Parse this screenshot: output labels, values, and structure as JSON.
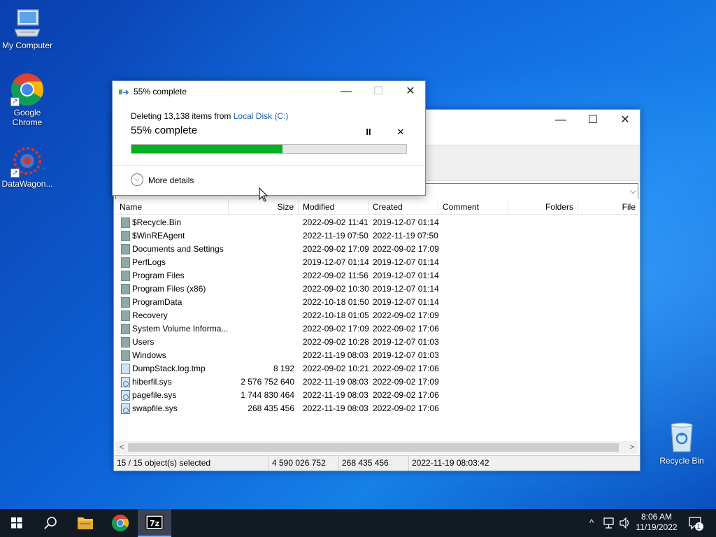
{
  "desktop": {
    "icons": [
      {
        "label": "My Computer"
      },
      {
        "label": "Google Chrome"
      },
      {
        "label": "DataWagon..."
      },
      {
        "label": "Recycle Bin"
      }
    ]
  },
  "progress_dialog": {
    "title": "55% complete",
    "deleting_prefix": "Deleting 13,138 items from ",
    "location_link": "Local Disk (C:)",
    "status_text": "55% complete",
    "progress_percent": 55,
    "more_details": "More details",
    "pause_glyph": "II",
    "cancel_glyph": "✕"
  },
  "window_controls": {
    "minimize": "—",
    "maximize": "☐",
    "close": "✕"
  },
  "file_list": {
    "columns": [
      "Name",
      "Size",
      "Modified",
      "Created",
      "Comment",
      "Folders",
      "File"
    ],
    "rows": [
      {
        "name": "$Recycle.Bin",
        "size": "",
        "modified": "2022-09-02 11:41",
        "created": "2019-12-07 01:14",
        "type": "folder"
      },
      {
        "name": "$WinREAgent",
        "size": "",
        "modified": "2022-11-19 07:50",
        "created": "2022-11-19 07:50",
        "type": "folder"
      },
      {
        "name": "Documents and Settings",
        "size": "",
        "modified": "2022-09-02 17:09",
        "created": "2022-09-02 17:09",
        "type": "folder"
      },
      {
        "name": "PerfLogs",
        "size": "",
        "modified": "2019-12-07 01:14",
        "created": "2019-12-07 01:14",
        "type": "folder"
      },
      {
        "name": "Program Files",
        "size": "",
        "modified": "2022-09-02 11:56",
        "created": "2019-12-07 01:14",
        "type": "folder"
      },
      {
        "name": "Program Files (x86)",
        "size": "",
        "modified": "2022-09-02 10:30",
        "created": "2019-12-07 01:14",
        "type": "folder"
      },
      {
        "name": "ProgramData",
        "size": "",
        "modified": "2022-10-18 01:50",
        "created": "2019-12-07 01:14",
        "type": "folder"
      },
      {
        "name": "Recovery",
        "size": "",
        "modified": "2022-10-18 01:05",
        "created": "2022-09-02 17:09",
        "type": "folder"
      },
      {
        "name": "System Volume Informa...",
        "size": "",
        "modified": "2022-09-02 17:09",
        "created": "2022-09-02 17:06",
        "type": "folder"
      },
      {
        "name": "Users",
        "size": "",
        "modified": "2022-09-02 10:28",
        "created": "2019-12-07 01:03",
        "type": "folder"
      },
      {
        "name": "Windows",
        "size": "",
        "modified": "2022-11-19 08:03",
        "created": "2019-12-07 01:03",
        "type": "folder"
      },
      {
        "name": "DumpStack.log.tmp",
        "size": "8 192",
        "modified": "2022-09-02 10:21",
        "created": "2022-09-02 17:06",
        "type": "file"
      },
      {
        "name": "hiberfil.sys",
        "size": "2 576 752 640",
        "modified": "2022-11-19 08:03",
        "created": "2022-09-02 17:09",
        "type": "sysfile"
      },
      {
        "name": "pagefile.sys",
        "size": "1 744 830 464",
        "modified": "2022-11-19 08:03",
        "created": "2022-09-02 17:06",
        "type": "sysfile"
      },
      {
        "name": "swapfile.sys",
        "size": "268 435 456",
        "modified": "2022-11-19 08:03",
        "created": "2022-09-02 17:06",
        "type": "sysfile"
      }
    ]
  },
  "status_bar": {
    "selected": "15 / 15 object(s) selected",
    "total_size": "4 590 026 752",
    "selected_size": "268 435 456",
    "modified": "2022-11-19 08:03:42"
  },
  "scroll_arrows": {
    "left": "<",
    "right": ">"
  },
  "address_dropdown": "⌵",
  "taskbar": {
    "time": "8:06 AM",
    "date": "11/19/2022",
    "notification_count": "1",
    "chevron": "^"
  },
  "colors": {
    "progress_green": "#06b025",
    "link_blue": "#1a5fb4",
    "taskbar": "#121a24"
  },
  "icons": [
    "my-computer-icon",
    "chrome-icon",
    "datawagon-icon",
    "recycle-bin-icon",
    "windows-start-icon",
    "search-icon",
    "file-explorer-icon",
    "7zip-icon",
    "network-icon",
    "volume-icon",
    "notification-icon"
  ]
}
